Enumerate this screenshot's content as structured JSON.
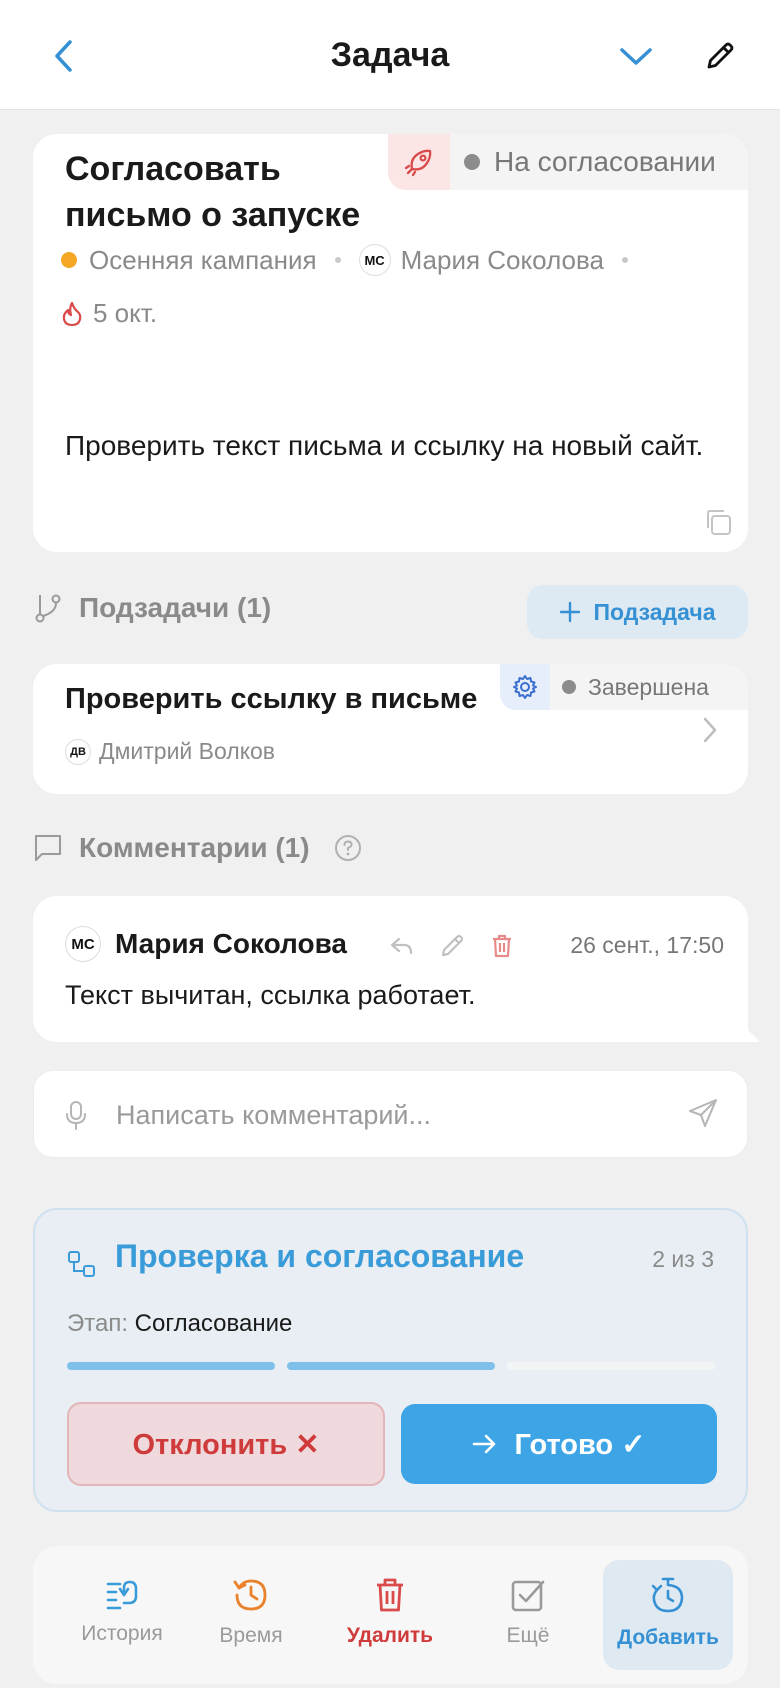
{
  "header": {
    "title": "Задача"
  },
  "task": {
    "title": "Согласовать письмо о запуске",
    "status": "На согласовании",
    "project": "Осенняя кампания",
    "assignee_initials": "МС",
    "assignee": "Мария Соколова",
    "due_date": "5 окт.",
    "description": "Проверить текст письма и ссылку на новый сайт."
  },
  "subtasks": {
    "header": "Подзадачи (1)",
    "add_label": "Подзадача",
    "items": [
      {
        "title": "Проверить ссылку в письме",
        "status": "Завершена",
        "assignee_initials": "ДВ",
        "assignee": "Дмитрий Волков"
      }
    ]
  },
  "comments": {
    "header": "Комментарии (1)",
    "items": [
      {
        "author_initials": "МС",
        "author": "Мария Соколова",
        "date": "26 сент., 17:50",
        "text": "Текст вычитан, ссылка работает."
      }
    ],
    "input_placeholder": "Написать комментарий..."
  },
  "workflow": {
    "title": "Проверка и согласование",
    "progress": "2 из 3",
    "stage_label": "Этап:",
    "stage_value": "Согласование",
    "steps_total": 3,
    "steps_done": 2,
    "reject_label": "Отклонить ✕",
    "ready_label": "Готово ✓"
  },
  "bottom_nav": {
    "items": [
      {
        "label": "История",
        "icon": "history-list-icon"
      },
      {
        "label": "Время",
        "icon": "clock-history-icon"
      },
      {
        "label": "Удалить",
        "icon": "trash-icon"
      },
      {
        "label": "Ещё",
        "icon": "checkbox-icon"
      },
      {
        "label": "Добавить",
        "icon": "timer-add-icon"
      }
    ]
  },
  "colors": {
    "accent": "#3da5e6",
    "danger": "#cf3b3b",
    "orange": "#f5a623",
    "time": "#e9822a"
  }
}
